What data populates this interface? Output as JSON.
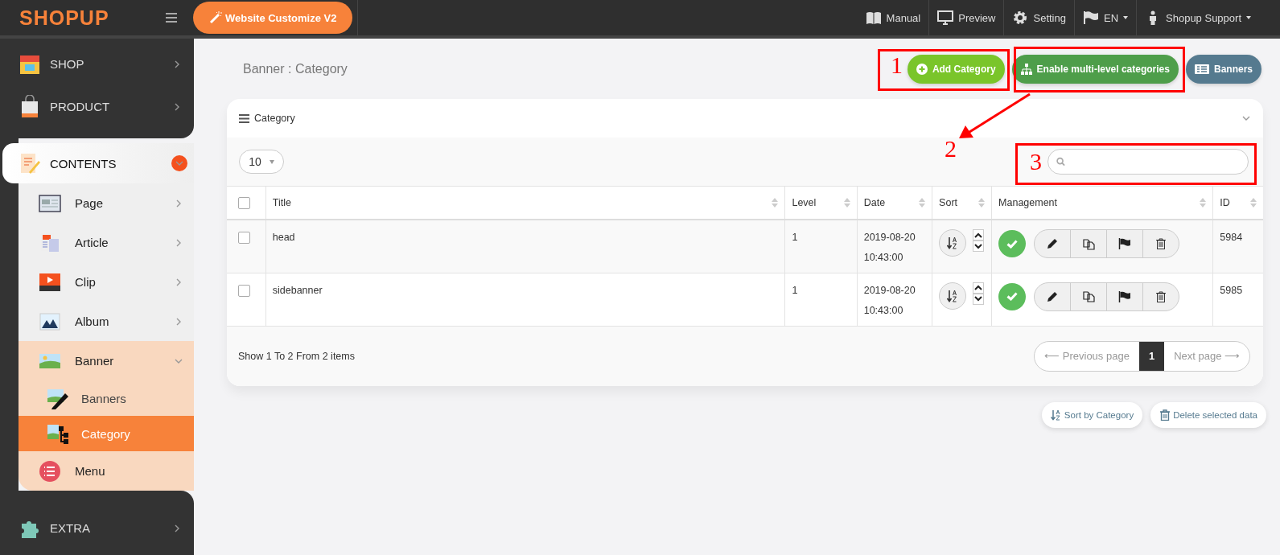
{
  "topbar": {
    "logo": "SHOPUP",
    "customize_button": "Website Customize V2",
    "links": [
      {
        "kind": "manual",
        "label": "Manual",
        "dropdown": false
      },
      {
        "kind": "preview",
        "label": "Preview",
        "dropdown": false
      },
      {
        "kind": "setting",
        "label": "Setting",
        "dropdown": false
      },
      {
        "kind": "language",
        "label": "EN",
        "dropdown": true
      },
      {
        "kind": "user",
        "label": "Shopup Support",
        "dropdown": true
      }
    ]
  },
  "sidebar": {
    "items": [
      {
        "kind": "shop",
        "label": "SHOP",
        "expanded": false
      },
      {
        "kind": "product",
        "label": "PRODUCT",
        "expanded": false
      },
      {
        "kind": "contents",
        "label": "CONTENTS",
        "expanded": true,
        "children": [
          {
            "kind": "page",
            "label": "Page",
            "expanded": false
          },
          {
            "kind": "article",
            "label": "Article",
            "expanded": false
          },
          {
            "kind": "clip",
            "label": "Clip",
            "expanded": false
          },
          {
            "kind": "album",
            "label": "Album",
            "expanded": false
          },
          {
            "kind": "banner",
            "label": "Banner",
            "expanded": true,
            "children": [
              {
                "kind": "banners",
                "label": "Banners",
                "selected": false
              },
              {
                "kind": "category",
                "label": "Category",
                "selected": true
              }
            ]
          },
          {
            "kind": "menu",
            "label": "Menu"
          }
        ]
      },
      {
        "kind": "extra",
        "label": "EXTRA",
        "expanded": false
      }
    ]
  },
  "page_title": "Banner : Category",
  "actions": [
    {
      "kind": "add",
      "label": "Add Category"
    },
    {
      "kind": "tree",
      "label": "Enable multi-level categories"
    },
    {
      "kind": "list",
      "label": "Banners"
    }
  ],
  "card": {
    "title": "Category",
    "page_size": "10",
    "table": {
      "header_checked": false,
      "columns": [
        {
          "label": "Title"
        },
        {
          "label": "Level"
        },
        {
          "label": "Date"
        },
        {
          "label": "Sort"
        },
        {
          "label": "Management"
        },
        {
          "label": "ID"
        }
      ],
      "rows": [
        {
          "checked": false,
          "title": "head",
          "level": "1",
          "date": "2019-08-20",
          "time": "10:43:00",
          "enabled": true,
          "id": "5984"
        },
        {
          "checked": false,
          "title": "sidebanner",
          "level": "1",
          "date": "2019-08-20",
          "time": "10:43:00",
          "enabled": true,
          "id": "5985"
        }
      ]
    },
    "summary": "Show 1 To 2 From 2 items",
    "pagination": [
      {
        "label": "⟵ Previous page",
        "selected": false
      },
      {
        "label": "1",
        "selected": true
      },
      {
        "label": "Next page ⟶",
        "selected": false
      }
    ]
  },
  "bottom_actions": [
    {
      "kind": "sort",
      "label": "Sort by Category"
    },
    {
      "kind": "delete",
      "label": "Delete selected data"
    }
  ],
  "annotations": [
    {
      "label": "1"
    },
    {
      "label": "2"
    },
    {
      "label": "3"
    }
  ]
}
